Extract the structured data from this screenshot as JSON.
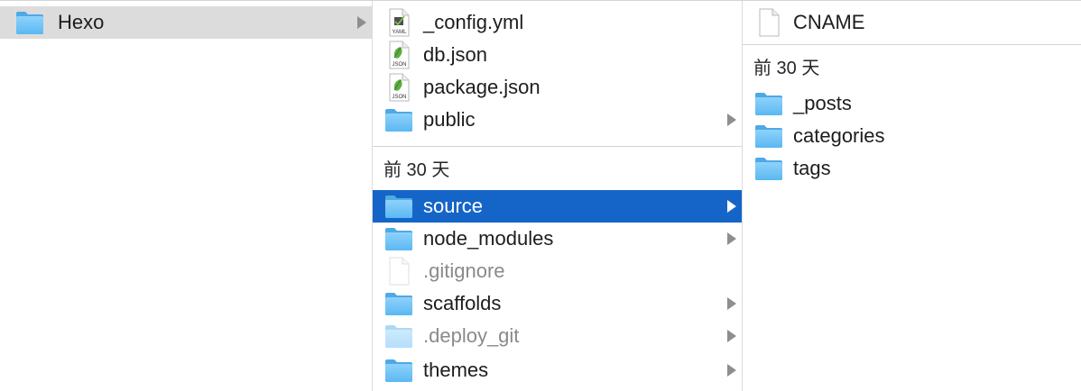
{
  "column1": {
    "items": [
      {
        "label": "Hexo",
        "icon": "folder-icon"
      }
    ]
  },
  "column2": {
    "top_items": [
      {
        "label": "_config.yml",
        "icon": "yaml-file-icon",
        "badge": "YAML"
      },
      {
        "label": "db.json",
        "icon": "json-file-icon",
        "badge": "JSON"
      },
      {
        "label": "package.json",
        "icon": "json-file-icon",
        "badge": "JSON"
      },
      {
        "label": "public",
        "icon": "folder-icon"
      }
    ],
    "group_header": "前 30 天",
    "group_items": [
      {
        "label": "source",
        "icon": "folder-icon",
        "selected": true
      },
      {
        "label": "node_modules",
        "icon": "folder-icon"
      },
      {
        "label": ".gitignore",
        "icon": "file-icon",
        "hidden": true
      },
      {
        "label": "scaffolds",
        "icon": "folder-icon"
      },
      {
        "label": ".deploy_git",
        "icon": "folder-icon",
        "hidden": true
      },
      {
        "label": "themes",
        "icon": "folder-icon"
      }
    ]
  },
  "column3": {
    "top_items": [
      {
        "label": "CNAME",
        "icon": "file-icon"
      }
    ],
    "group_header": "前 30 天",
    "group_items": [
      {
        "label": "_posts",
        "icon": "folder-icon"
      },
      {
        "label": "categories",
        "icon": "folder-icon"
      },
      {
        "label": "tags",
        "icon": "folder-icon"
      }
    ]
  },
  "colors": {
    "selection": "#1565c8",
    "inactive_selection": "#dcdcdc",
    "folder": "#6cc1f5"
  }
}
